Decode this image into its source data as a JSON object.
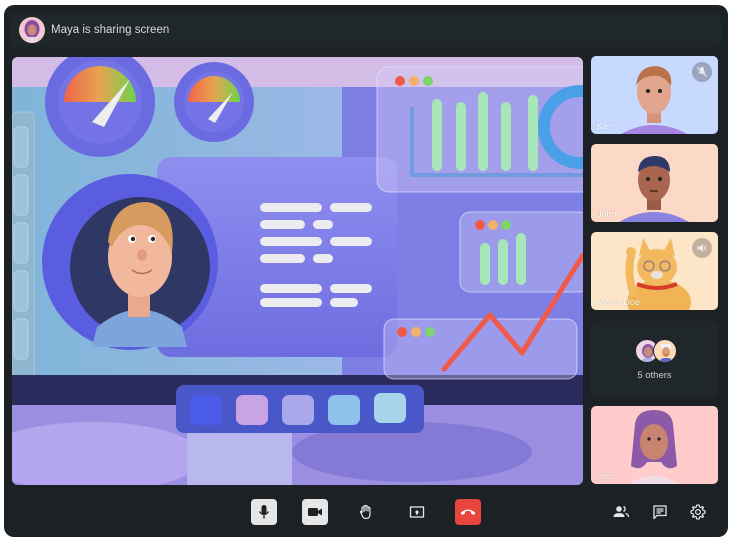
{
  "header": {
    "presenter_name": "Maya",
    "sharing_status": "Maya is sharing screen"
  },
  "main_share": {
    "description": "Shared screen showing a 3D dashboard illustration",
    "window_dots": [
      "#ef5a47",
      "#f2b06a",
      "#7dd46b"
    ]
  },
  "participants": [
    {
      "name": "Ken",
      "background": "#c7d9ff",
      "status_icon": "mic-off-icon"
    },
    {
      "name": "John",
      "background": "#fcd9c6",
      "status_icon": null
    },
    {
      "name": "Meow Doe",
      "background": "#fde5c8",
      "status_icon": "speaker-icon"
    },
    {
      "name": "You",
      "background": "#ffcbcb",
      "status_icon": null
    }
  ],
  "others": {
    "label": "5 others",
    "count": 5
  },
  "controls": {
    "mic": {
      "icon": "microphone-icon",
      "label": "Microphone",
      "active": true
    },
    "camera": {
      "icon": "video-camera-icon",
      "label": "Camera",
      "active": true
    },
    "raise_hand": {
      "icon": "raise-hand-icon",
      "label": "Raise hand"
    },
    "share": {
      "icon": "share-screen-icon",
      "label": "Share screen"
    },
    "end_call": {
      "icon": "hang-up-icon",
      "label": "End call",
      "color": "#e8453c"
    },
    "people": {
      "icon": "people-icon",
      "label": "Participants"
    },
    "chat": {
      "icon": "chat-icon",
      "label": "Chat"
    },
    "settings": {
      "icon": "gear-icon",
      "label": "Settings"
    }
  }
}
